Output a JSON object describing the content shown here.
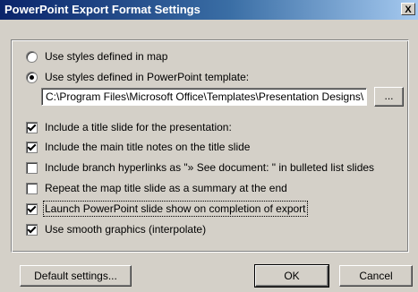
{
  "window": {
    "title": "PowerPoint Export Format Settings",
    "close_glyph": "X"
  },
  "styles": {
    "option_map": "Use styles defined in map",
    "option_template": "Use styles defined in PowerPoint template:",
    "selected": "template",
    "template_path": "C:\\Program Files\\Microsoft Office\\Templates\\Presentation Designs\\",
    "browse_label": "..."
  },
  "options": [
    {
      "label": "Include a title slide for the presentation:",
      "checked": true
    },
    {
      "label": "Include the main title notes on the title slide",
      "checked": true
    },
    {
      "label": "Include branch hyperlinks as \"» See document:  \" in bulleted list slides",
      "checked": false
    },
    {
      "label": "Repeat the map title slide as a summary at the end",
      "checked": false
    },
    {
      "label": "Launch PowerPoint slide show on completion of export",
      "checked": true
    },
    {
      "label": "Use smooth graphics (interpolate)",
      "checked": true
    }
  ],
  "buttons": {
    "default": "Default settings...",
    "ok": "OK",
    "cancel": "Cancel"
  }
}
